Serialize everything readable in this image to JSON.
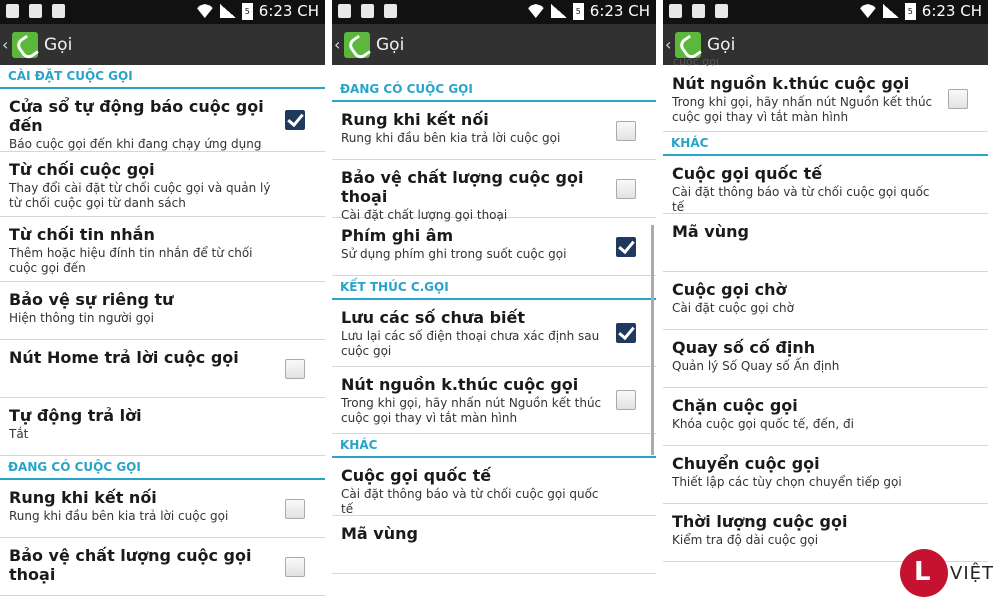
{
  "status": {
    "time": "6:23 CH",
    "battery": "5"
  },
  "panel1": {
    "app_title": "Gọi",
    "sections": [
      {
        "label": "CÀI ĐẶT CUỘC GỌI",
        "items": [
          {
            "title": "Cửa sổ tự động báo cuộc gọi đến",
            "subtitle": "Báo cuộc gọi đến khi đang chạy ứng dụng",
            "checkbox": true,
            "checked": true
          },
          {
            "title": "Từ chối cuộc gọi",
            "subtitle": "Thay đổi cài đặt từ chối cuộc gọi và quản lý từ chối cuộc gọi từ danh sách",
            "checkbox": false
          },
          {
            "title": "Từ chối tin nhắn",
            "subtitle": "Thêm hoặc hiệu đính tin nhắn để từ chối cuộc gọi đến",
            "checkbox": false
          },
          {
            "title": "Bảo vệ sự riêng tư",
            "subtitle": "Hiện thông tin người gọi",
            "checkbox": false
          },
          {
            "title": "Nút Home trả lời cuộc gọi",
            "subtitle": "",
            "checkbox": true,
            "checked": false
          },
          {
            "title": "Tự động trả lời",
            "subtitle": "Tắt",
            "checkbox": false
          }
        ]
      },
      {
        "label": "ĐANG CÓ CUỘC GỌI",
        "items": [
          {
            "title": "Rung khi kết nối",
            "subtitle": "Rung khi đầu bên kia trả lời cuộc gọi",
            "checkbox": true,
            "checked": false
          },
          {
            "title": "Bảo vệ chất lượng cuộc gọi thoại",
            "subtitle": "",
            "checkbox": true,
            "checked": false
          }
        ]
      }
    ]
  },
  "panel2": {
    "app_title": "Gọi",
    "sections": [
      {
        "label": "ĐANG CÓ CUỘC GỌI",
        "items": [
          {
            "title": "Rung khi kết nối",
            "subtitle": "Rung khi đầu bên kia trả lời cuộc gọi",
            "checkbox": true,
            "checked": false
          },
          {
            "title": "Bảo vệ chất lượng cuộc gọi thoại",
            "subtitle": "Cài đặt chất lượng gọi thoại",
            "checkbox": true,
            "checked": false
          },
          {
            "title": "Phím ghi âm",
            "subtitle": "Sử dụng phím ghi trong suốt cuộc gọi",
            "checkbox": true,
            "checked": true
          }
        ]
      },
      {
        "label": "KẾT THÚC C.GỌI",
        "items": [
          {
            "title": "Lưu các số chưa biết",
            "subtitle": "Lưu lại các số điện thoại chưa xác định sau cuộc gọi",
            "checkbox": true,
            "checked": true
          },
          {
            "title": "Nút nguồn k.thúc cuộc gọi",
            "subtitle": "Trong khi gọi, hãy nhấn nút Nguồn kết thúc cuộc gọi thay vì tắt màn hình",
            "checkbox": true,
            "checked": false
          }
        ]
      },
      {
        "label": "KHÁC",
        "items": [
          {
            "title": "Cuộc gọi quốc tế",
            "subtitle": "Cài đặt thông báo và từ chối cuộc gọi quốc tế",
            "checkbox": false
          },
          {
            "title": "Mã vùng",
            "subtitle": "",
            "checkbox": false
          }
        ]
      }
    ]
  },
  "panel3": {
    "app_title": "Gọi",
    "partial_top": "cuộc gọi",
    "sections": [
      {
        "label": "",
        "items": [
          {
            "title": "Nút nguồn k.thúc cuộc gọi",
            "subtitle": "Trong khi gọi, hãy nhấn nút Nguồn kết thúc cuộc gọi thay vì tắt màn hình",
            "checkbox": true,
            "checked": false
          }
        ]
      },
      {
        "label": "KHÁC",
        "items": [
          {
            "title": "Cuộc gọi quốc tế",
            "subtitle": "Cài đặt thông báo và từ chối cuộc gọi quốc tế",
            "checkbox": false
          },
          {
            "title": "Mã vùng",
            "subtitle": "",
            "checkbox": false
          },
          {
            "title": "Cuộc gọi chờ",
            "subtitle": "Cài đặt cuộc gọi chờ",
            "checkbox": false
          },
          {
            "title": "Quay số cố định",
            "subtitle": "Quản lý Số Quay số Ấn định",
            "checkbox": false
          },
          {
            "title": "Chặn cuộc gọi",
            "subtitle": "Khóa cuộc gọi quốc tế, đến, đi",
            "checkbox": false
          },
          {
            "title": "Chuyển cuộc gọi",
            "subtitle": "Thiết lập các tùy chọn chuyển tiếp gọi",
            "checkbox": false
          },
          {
            "title": "Thời lượng cuộc gọi",
            "subtitle": "Kiểm tra độ dài cuộc gọi",
            "checkbox": false
          }
        ]
      }
    ]
  },
  "watermark": {
    "brand_text": "VIỆT"
  },
  "colors": {
    "accent": "#2aa3c9",
    "appbar": "#313131",
    "statusbar": "#111111",
    "phone_icon": "#5bb83c"
  }
}
